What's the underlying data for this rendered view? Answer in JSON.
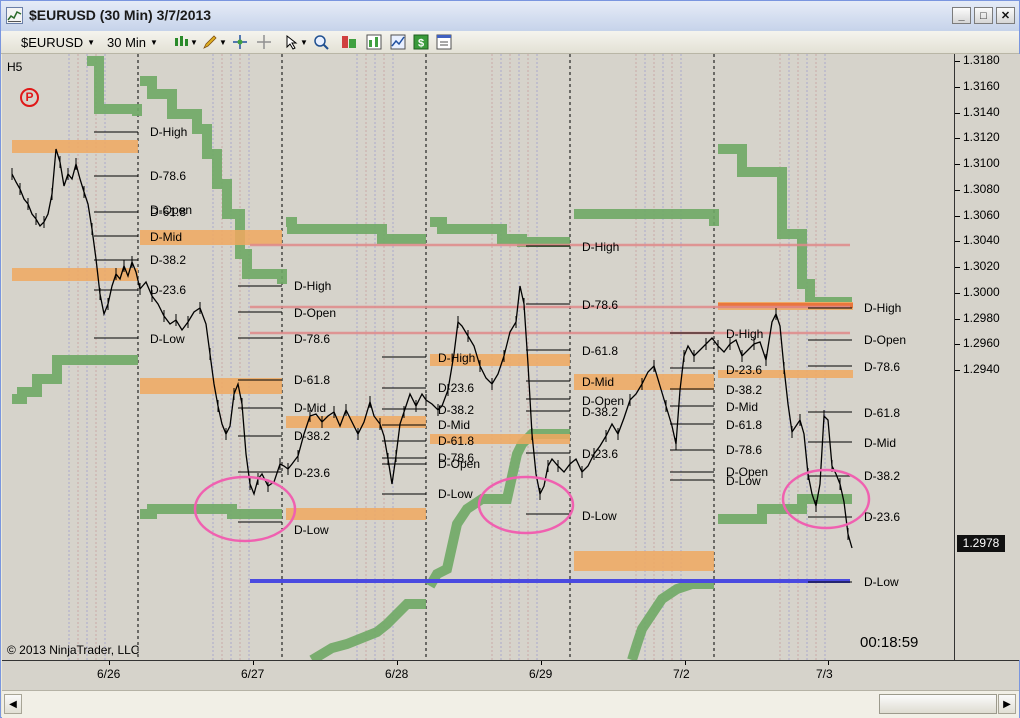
{
  "window": {
    "title": "$EURUSD (30 Min)  3/7/2013",
    "buttons": [
      "_",
      "□",
      "✕"
    ]
  },
  "toolbar": {
    "instrument": "$EURUSD",
    "interval": "30 Min",
    "tools": [
      "candlestick-style-icon",
      "pencil-icon",
      "crosshair-icon",
      "global-crosshair-icon",
      "pointer-icon",
      "zoom-icon",
      "data-box-icon",
      "indicators-icon",
      "strategies-icon",
      "dollar-icon",
      "properties-icon"
    ]
  },
  "chart": {
    "panel_label": "H5",
    "copyright": "© 2013 NinjaTrader, LLC",
    "timer": "00:18:59",
    "current_price": "1.2978",
    "price_ticks": [
      "1.3180",
      "1.3160",
      "1.3140",
      "1.3120",
      "1.3100",
      "1.3080",
      "1.3060",
      "1.3040",
      "1.3020",
      "1.3000",
      "1.2980",
      "1.2960",
      "1.2940"
    ],
    "date_ticks": [
      "6/26",
      "6/27",
      "6/28",
      "6/29",
      "7/2",
      "7/3"
    ],
    "level_labels": [
      "D-High",
      "D-78.6",
      "D-61.8",
      "D-Open",
      "D-Mid",
      "D-38.2",
      "D-23.6",
      "D-Low",
      "D-High",
      "D-Open",
      "D-78.6",
      "D-61.8",
      "D-Mid",
      "D-38.2",
      "D-23.6",
      "D-Low",
      "D-High",
      "D-23.6",
      "D-38.2",
      "D-Mid",
      "D-61.8",
      "D-78.6",
      "D-Open",
      "D-Low",
      "D-High",
      "D-78.6",
      "D-61.8",
      "D-Mid",
      "D-Open",
      "D-38.2",
      "D-23.6",
      "D-Low",
      "D-High",
      "D-23.6",
      "D-38.2",
      "D-Mid",
      "D-61.8",
      "D-78.6",
      "D-Open",
      "D-Low",
      "D-High",
      "D-Open",
      "D-78.6",
      "D-61.8",
      "D-Mid",
      "D-38.2",
      "D-23.6",
      "D-Low"
    ]
  },
  "colors": {
    "background": "#d6d3cb",
    "green_band": "#6fa865",
    "orange_band": "#f0a860",
    "pink_line": "#e08a8a",
    "blue_line": "#4a4ae0",
    "ellipse": "#f060b0",
    "logo": "#e01818"
  }
}
